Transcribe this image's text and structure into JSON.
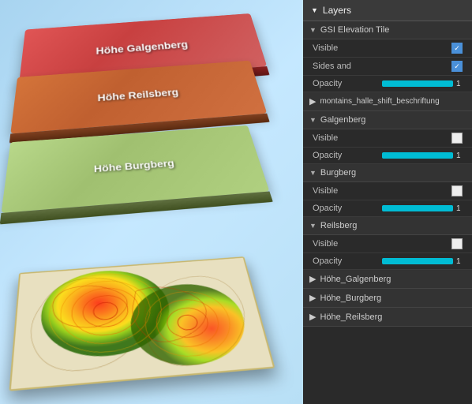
{
  "header": {
    "layers_label": "Layers"
  },
  "map": {
    "layers": [
      {
        "label": "Höhe Galgenberg",
        "type": "red"
      },
      {
        "label": "Höhe Reilsberg",
        "type": "orange"
      },
      {
        "label": "Höhe Burgberg",
        "type": "green"
      },
      {
        "label": "terrain",
        "type": "terrain"
      }
    ]
  },
  "layers_panel": {
    "sections": [
      {
        "id": "gsi_elevation_tile",
        "label": "GSI Elevation Tile",
        "expanded": true,
        "arrow": "▼",
        "properties": [
          {
            "id": "visible",
            "label": "Visible",
            "type": "checkbox",
            "checked": true
          },
          {
            "id": "sides_and",
            "label": "Sides and",
            "type": "checkbox",
            "checked": true
          },
          {
            "id": "opacity",
            "label": "Opacity",
            "type": "slider",
            "value": "1"
          }
        ]
      },
      {
        "id": "montains_halle_shift",
        "label": "montains_halle_shift_beschriftung",
        "expanded": false,
        "arrow": "▶"
      },
      {
        "id": "galgenberg",
        "label": "Galgenberg",
        "expanded": true,
        "arrow": "▼",
        "properties": [
          {
            "id": "visible",
            "label": "Visible",
            "type": "checkbox",
            "checked": false
          },
          {
            "id": "opacity",
            "label": "Opacity",
            "type": "slider",
            "value": "1"
          }
        ]
      },
      {
        "id": "burgberg",
        "label": "Burgberg",
        "expanded": true,
        "arrow": "▼",
        "properties": [
          {
            "id": "visible",
            "label": "Visible",
            "type": "checkbox",
            "checked": false
          },
          {
            "id": "opacity",
            "label": "Opacity",
            "type": "slider",
            "value": "1"
          }
        ]
      },
      {
        "id": "reilsberg",
        "label": "Reilsberg",
        "expanded": true,
        "arrow": "▼",
        "properties": [
          {
            "id": "visible",
            "label": "Visible",
            "type": "checkbox",
            "checked": false
          },
          {
            "id": "opacity",
            "label": "Opacity",
            "type": "slider",
            "value": "1"
          }
        ]
      },
      {
        "id": "hohe_galgenberg",
        "label": "Höhe_Galgenberg",
        "expanded": false,
        "arrow": "▶"
      },
      {
        "id": "hohe_burgberg",
        "label": "Höhe_Burgberg",
        "expanded": false,
        "arrow": "▶"
      },
      {
        "id": "hohe_reilsberg",
        "label": "Höhe_Reilsberg",
        "expanded": false,
        "arrow": "▶"
      }
    ],
    "labels": {
      "visible": "Visible",
      "sides_and": "Sides and",
      "opacity": "Opacity"
    }
  }
}
